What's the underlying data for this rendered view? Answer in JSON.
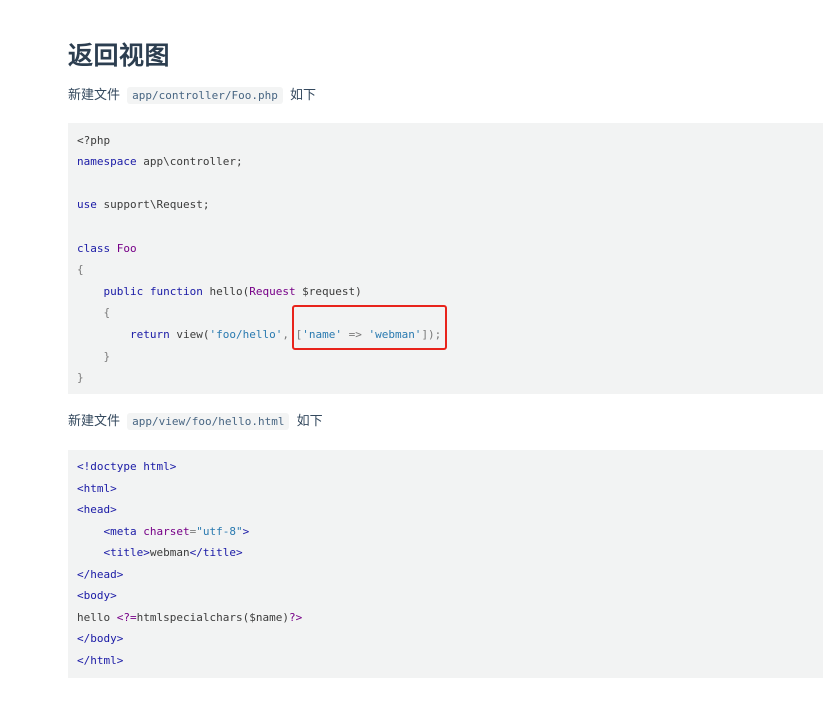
{
  "heading": "返回视图",
  "para1": {
    "prefix": "新建文件",
    "path": "app/controller/Foo.php",
    "suffix": "如下"
  },
  "code1": {
    "l1": "<?php",
    "l2_kw": "namespace",
    "l2_rest": " app\\controller;",
    "l4_kw": "use",
    "l4_rest": " support\\Request;",
    "l6_kw": "class",
    "l6_name": " Foo",
    "l7": "{",
    "l8_kw": "    public function",
    "l8_fn": " hello(",
    "l8_type": "Request",
    "l8_var": " $request)",
    "l9": "    {",
    "l10_kw": "        return",
    "l10_fn": " view(",
    "l10_s1": "'foo/hello'",
    "l10_p1": ", [",
    "l10_s2": "'name'",
    "l10_p2": " => ",
    "l10_s3": "'webman'",
    "l10_p3": "]);",
    "l11": "    }",
    "l12": "}"
  },
  "para2": {
    "prefix": "新建文件",
    "path": "app/view/foo/hello.html",
    "suffix": "如下"
  },
  "code2": {
    "l1": "<!doctype html>",
    "l2": "<html>",
    "l3": "<head>",
    "l4_a": "    <meta ",
    "l4_attr": "charset",
    "l4_eq": "=",
    "l4_val": "\"utf-8\"",
    "l4_end": ">",
    "l5_a": "    <title>",
    "l5_text": "webman",
    "l5_b": "</title>",
    "l6": "</head>",
    "l7": "<body>",
    "l8_text": "hello ",
    "l8_php": "<?=",
    "l8_rest": "htmlspecialchars($name)",
    "l8_end": "?>",
    "l9": "</body>",
    "l10": "</html>"
  },
  "colors": {
    "highlight": "#e8231b",
    "code_bg": "#f2f3f3",
    "heading": "#2c3e50"
  }
}
